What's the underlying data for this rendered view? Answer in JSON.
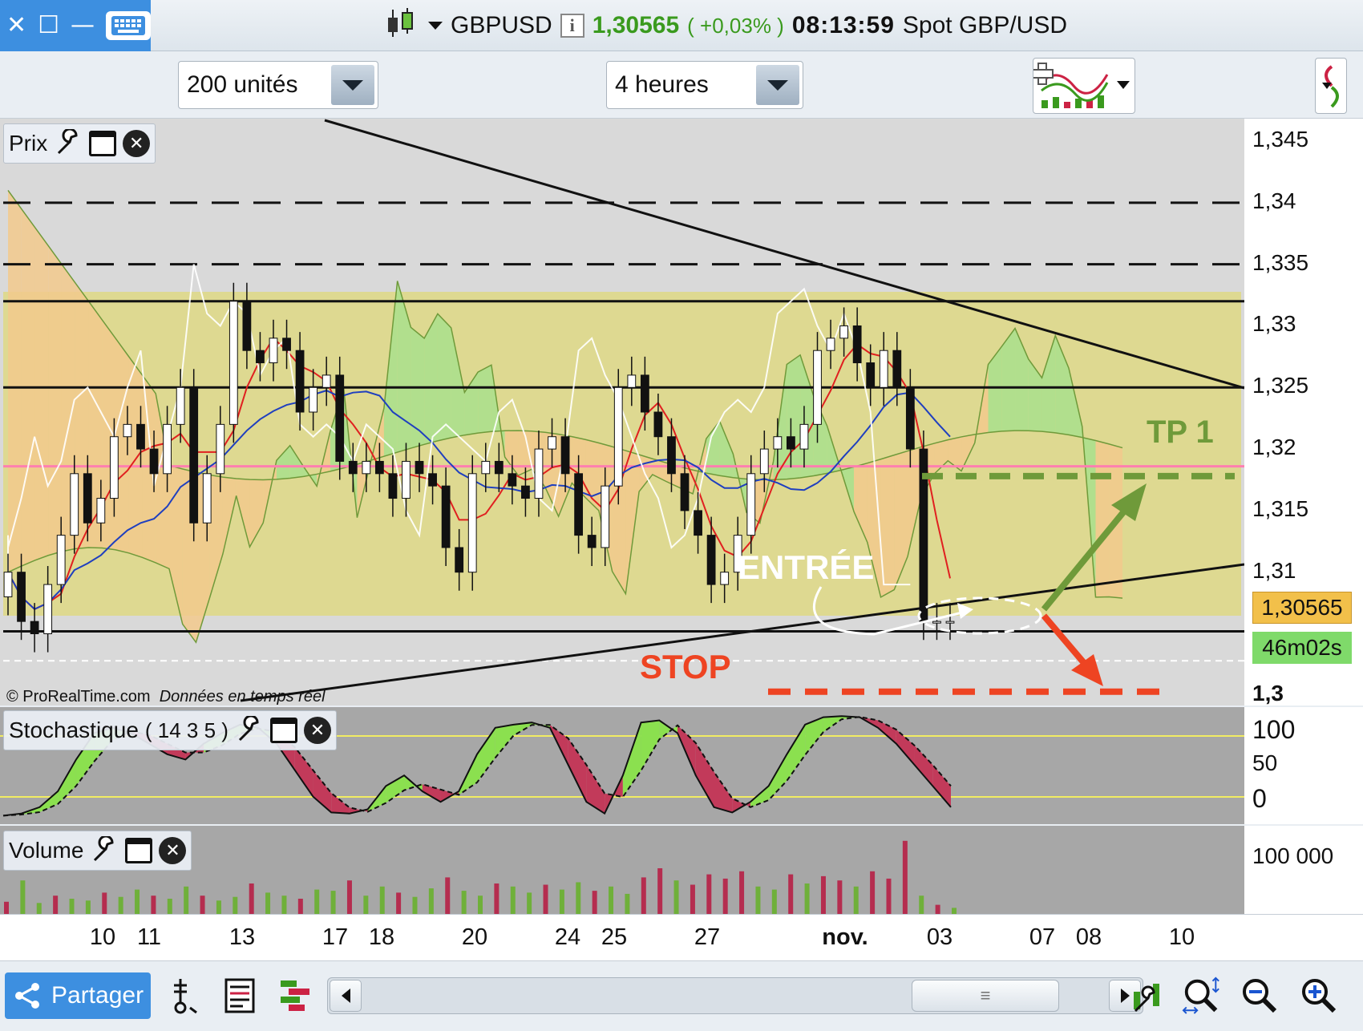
{
  "titlebar": {
    "symbol": "GBPUSD",
    "last_price": "1,30565",
    "change": "( +0,03% )",
    "time": "08:13:59",
    "instrument": "Spot GBP/USD",
    "colors": {
      "window_controls": "#3d8fe0",
      "price_up": "#3a9a1e"
    }
  },
  "toolbar": {
    "units_select": "200 unités",
    "timeframe_select": "4 heures"
  },
  "price_panel": {
    "label": "Prix",
    "watermark_brand": "© ProRealTime.com",
    "watermark_text": "Données en temps réel",
    "annotations": {
      "entry": "ENTRÉE",
      "stop": "STOP",
      "tp1": "TP 1"
    },
    "current_price_tag": "1,30565",
    "candle_timer": "46m02s",
    "y_ticks": [
      "1,345",
      "1,34",
      "1,335",
      "1,33",
      "1,325",
      "1,32",
      "1,315",
      "1,31",
      "1,3"
    ],
    "colors": {
      "range_zone": "#ded991",
      "kumo_bull": "#a9df8c",
      "kumo_bear": "#f2c98c",
      "pink_line": "#ff7fb0",
      "tp_line": "#6f9a3a",
      "stop_line": "#ee4422"
    }
  },
  "stoch_panel": {
    "label": "Stochastique",
    "params": "( 14 3 5 )",
    "y_ticks": [
      "100",
      "50",
      "0"
    ]
  },
  "volume_panel": {
    "label": "Volume",
    "y_ticks": [
      "100 000"
    ]
  },
  "date_axis": [
    "10",
    "11",
    "13",
    "17",
    "18",
    "20",
    "24",
    "25",
    "27",
    "nov.",
    "03",
    "07",
    "08",
    "10"
  ],
  "bottombar": {
    "share_label": "Partager"
  },
  "chart_data": {
    "type": "candlestick",
    "title": "GBPUSD",
    "ylim": [
      1.2995,
      1.3465
    ],
    "horizontal_levels": {
      "dashed_resistance": [
        1.34,
        1.335
      ],
      "range_top": 1.332,
      "mid_level": 1.325,
      "range_bottom": 1.3052,
      "pink_level": 1.3186,
      "tp1": 1.3178,
      "stop": 1.3003,
      "white_dashed": 1.3028
    },
    "close_path": [
      1.31,
      1.306,
      1.305,
      1.309,
      1.313,
      1.318,
      1.314,
      1.316,
      1.321,
      1.322,
      1.32,
      1.318,
      1.322,
      1.325,
      1.314,
      1.318,
      1.322,
      1.332,
      1.328,
      1.327,
      1.329,
      1.328,
      1.323,
      1.325,
      1.326,
      1.319,
      1.318,
      1.319,
      1.318,
      1.316,
      1.319,
      1.318,
      1.317,
      1.312,
      1.31,
      1.318,
      1.319,
      1.318,
      1.317,
      1.316,
      1.32,
      1.321,
      1.318,
      1.313,
      1.312,
      1.317,
      1.325,
      1.326,
      1.323,
      1.321,
      1.318,
      1.315,
      1.313,
      1.309,
      1.31,
      1.313,
      1.318,
      1.32,
      1.321,
      1.32,
      1.322,
      1.328,
      1.329,
      1.33,
      1.327,
      1.325,
      1.328,
      1.325,
      1.32,
      1.306,
      1.306,
      1.306
    ],
    "stochastic_k": [
      2,
      4,
      10,
      25,
      55,
      80,
      85,
      80,
      70,
      60,
      55,
      70,
      80,
      88,
      85,
      70,
      45,
      20,
      5,
      4,
      8,
      30,
      40,
      25,
      15,
      25,
      60,
      85,
      88,
      90,
      85,
      50,
      15,
      4,
      40,
      90,
      92,
      80,
      40,
      10,
      5,
      15,
      30,
      60,
      88,
      95,
      96,
      95,
      85,
      70,
      50,
      30,
      10
    ],
    "volume": [
      20,
      55,
      18,
      30,
      25,
      22,
      35,
      28,
      40,
      30,
      25,
      45,
      30,
      22,
      28,
      50,
      35,
      30,
      25,
      40,
      38,
      55,
      30,
      45,
      35,
      28,
      42,
      60,
      38,
      30,
      50,
      45,
      35,
      48,
      40,
      52,
      38,
      45,
      33,
      60,
      75,
      55,
      48,
      65,
      58,
      70,
      45,
      40,
      65,
      50,
      62,
      55,
      45,
      70,
      58,
      120,
      30,
      15,
      10
    ]
  }
}
